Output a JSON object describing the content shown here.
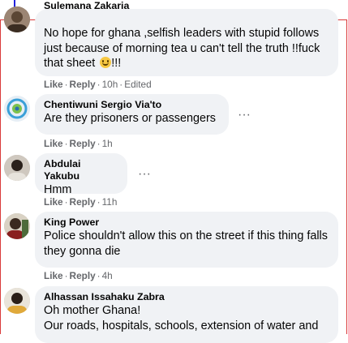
{
  "comments": [
    {
      "author": "Sulemana Zakaria",
      "text": "No hope for ghana ,selfish leaders with stupid follows just because of morning tea u can't tell the truth !!fuck that sheet",
      "text_suffix": "!!!",
      "emoji": "grinning-face-emoji",
      "like": "Like",
      "reply": "Reply",
      "time": "10h",
      "edited": "Edited"
    },
    {
      "author": "Chentiwuni Sergio Via'to",
      "text": "Are they prisoners or passengers",
      "like": "Like",
      "reply": "Reply",
      "time": "1h"
    },
    {
      "author": "Abdulai Yakubu",
      "text": "Hmm",
      "like": "Like",
      "reply": "Reply",
      "time": "11h"
    },
    {
      "author": "King Power",
      "text": "Police shouldn't allow this on the street if this thing falls they gonna die",
      "like": "Like",
      "reply": "Reply",
      "time": "4h"
    },
    {
      "author": "Alhassan Issahaku Zabra",
      "text_line1": "Oh mother Ghana!",
      "text_line2": "Our roads, hospitals, schools, extension of water and"
    }
  ],
  "separator": "·",
  "more_label": "···",
  "colors": {
    "bubble": "#f0f2f5",
    "secondary_text": "#65676b",
    "frame_border": "#d93a3a",
    "cursor_line": "#2222dd"
  }
}
